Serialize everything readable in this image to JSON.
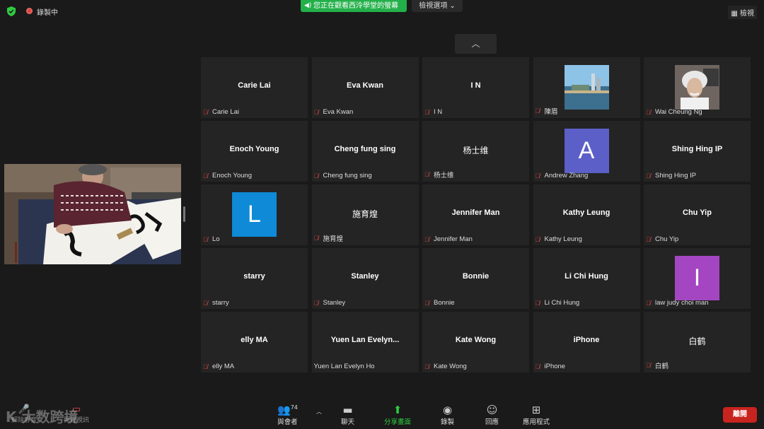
{
  "topbar": {
    "recording_label": "錄製中",
    "share_notice": "您正在觀看西泠學堂的螢幕",
    "view_options": "檢視選項 ⌄",
    "view_button": "檢視"
  },
  "participants": [
    {
      "display": "Carie Lai",
      "name": "Carie Lai",
      "type": "text"
    },
    {
      "display": "Eva Kwan",
      "name": "Eva Kwan",
      "type": "text"
    },
    {
      "display": "I N",
      "name": "I N",
      "type": "text"
    },
    {
      "display": "",
      "name": "陳眉",
      "type": "photo-city"
    },
    {
      "display": "",
      "name": "Wai Cheung Ng",
      "type": "photo-einstein"
    },
    {
      "display": "Enoch Young",
      "name": "Enoch Young",
      "type": "text"
    },
    {
      "display": "Cheng fung sing",
      "name": "Cheng fung sing",
      "type": "text"
    },
    {
      "display": "杨士维",
      "name": "杨士维",
      "type": "text-cjk"
    },
    {
      "display": "A",
      "name": "Andrew Zhang",
      "type": "letter",
      "color": "#5b5fc7"
    },
    {
      "display": "Shing Hing IP",
      "name": "Shing Hing IP",
      "type": "text"
    },
    {
      "display": "L",
      "name": "Lo",
      "type": "letter",
      "color": "#0e8ad6"
    },
    {
      "display": "施育煌",
      "name": "施育煌",
      "type": "text-cjk"
    },
    {
      "display": "Jennifer Man",
      "name": "Jennifer Man",
      "type": "text"
    },
    {
      "display": "Kathy Leung",
      "name": "Kathy Leung",
      "type": "text"
    },
    {
      "display": "Chu Yip",
      "name": "Chu Yip",
      "type": "text"
    },
    {
      "display": "starry",
      "name": "starry",
      "type": "text"
    },
    {
      "display": "Stanley",
      "name": "Stanley",
      "type": "text"
    },
    {
      "display": "Bonnie",
      "name": "Bonnie",
      "type": "text"
    },
    {
      "display": "Li Chi Hung",
      "name": "Li Chi Hung",
      "type": "text"
    },
    {
      "display": "I",
      "name": "law judy choi man",
      "type": "letter",
      "color": "#a446c2"
    },
    {
      "display": "elly MA",
      "name": "elly MA",
      "type": "text"
    },
    {
      "display": "Yuen  Lan  Evelyn...",
      "name": "Yuen Lan Evelyn Ho",
      "type": "text",
      "nomic": true
    },
    {
      "display": "Kate Wong",
      "name": "Kate Wong",
      "type": "text"
    },
    {
      "display": "iPhone",
      "name": "iPhone",
      "type": "text"
    },
    {
      "display": "白鹤",
      "name": "白鹤",
      "type": "text-cjk"
    }
  ],
  "toolbar": {
    "participants_label": "與會者",
    "participants_count": "74",
    "chat_label": "聊天",
    "share_label": "分享畫面",
    "record_label": "錄製",
    "reactions_label": "回應",
    "apps_label": "應用程式",
    "end_label": "離開",
    "unmute_label": "解除靜音",
    "video_label": "開啟視訊"
  },
  "watermark": "K 大数跨境",
  "colors": {
    "accent_green": "#2ecc40",
    "end_red": "#c8241f",
    "muted_red": "#e04848"
  }
}
